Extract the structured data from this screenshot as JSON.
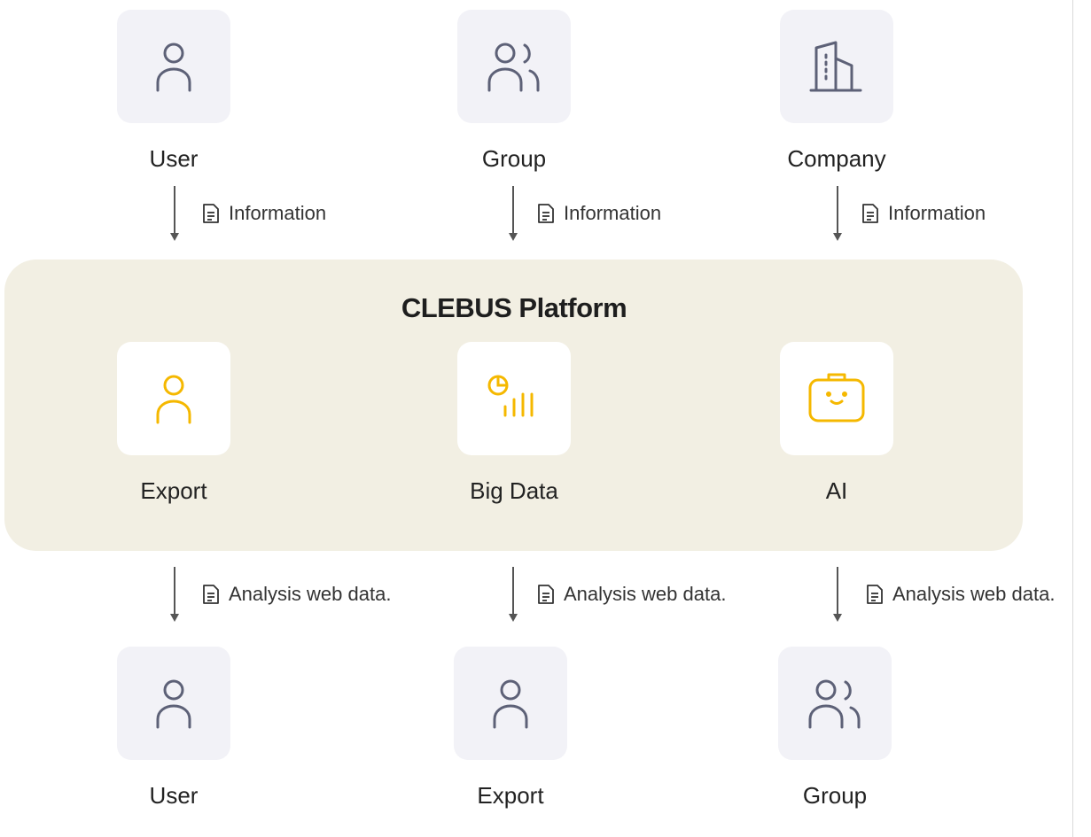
{
  "inputs": [
    {
      "label": "User",
      "icon": "user-icon"
    },
    {
      "label": "Group",
      "icon": "group-icon"
    },
    {
      "label": "Company",
      "icon": "building-icon"
    }
  ],
  "input_flow_label": "Information",
  "platform": {
    "title": "CLEBUS Platform",
    "modules": [
      {
        "label": "Export",
        "icon": "user-icon"
      },
      {
        "label": "Big Data",
        "icon": "chart-icon"
      },
      {
        "label": "AI",
        "icon": "robot-icon"
      }
    ]
  },
  "output_flow_label": "Analysis web data.",
  "outputs": [
    {
      "label": "User",
      "icon": "user-icon"
    },
    {
      "label": "Export",
      "icon": "user-icon"
    },
    {
      "label": "Group",
      "icon": "group-icon"
    }
  ],
  "colors": {
    "tile_grey": "#f2f2f7",
    "icon_grey": "#5d6177",
    "icon_yellow": "#f5b800",
    "platform_bg": "#f2efe3"
  }
}
